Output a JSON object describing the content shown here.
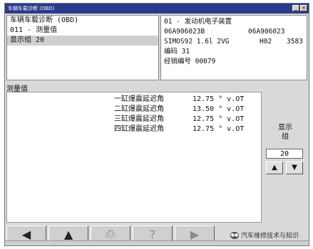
{
  "window": {
    "title": "车辆车载诊断 (OBD)"
  },
  "left_info": {
    "lines": [
      "车辆车载诊断 (OBD)",
      "011 - 测量值",
      "显示组 20"
    ]
  },
  "right_info": {
    "module": "01 - 发动机电子装置",
    "part_no_1": "06A906023B",
    "part_no_2": "06A906023",
    "engine": "SIMOS92 1.6l 2VG",
    "hw": "H02",
    "code_val": "3583",
    "coding": "编码 31",
    "dealer": "经销编号 00079"
  },
  "section": {
    "label": "测量值"
  },
  "values": [
    {
      "label": "一缸爆震延迟角",
      "value": "12.75 ° v.OT"
    },
    {
      "label": "二缸爆震延迟角",
      "value": "13.50 ° v.OT"
    },
    {
      "label": "三缸爆震延迟角",
      "value": "12.75 ° v.OT"
    },
    {
      "label": "四缸爆震延迟角",
      "value": "12.75 ° v.OT"
    }
  ],
  "side": {
    "label_line1": "显示",
    "label_line2": "组",
    "group_value": "20",
    "up_glyph": "▲",
    "down_glyph": "▼"
  },
  "toolbar": {
    "buttons": [
      {
        "name": "back-icon",
        "glyph": "◀"
      },
      {
        "name": "up-icon",
        "glyph": "▲"
      },
      {
        "name": "print-icon",
        "glyph": "⎙"
      },
      {
        "name": "help-icon",
        "glyph": "?"
      },
      {
        "name": "forward-icon",
        "glyph": "▶"
      }
    ]
  },
  "watermark": {
    "text": "汽车维修技术与知识"
  },
  "colors": {
    "titlebar": "#2a3a8c",
    "panel": "#d9d9d9",
    "selected_row": "#cfcfcf"
  }
}
